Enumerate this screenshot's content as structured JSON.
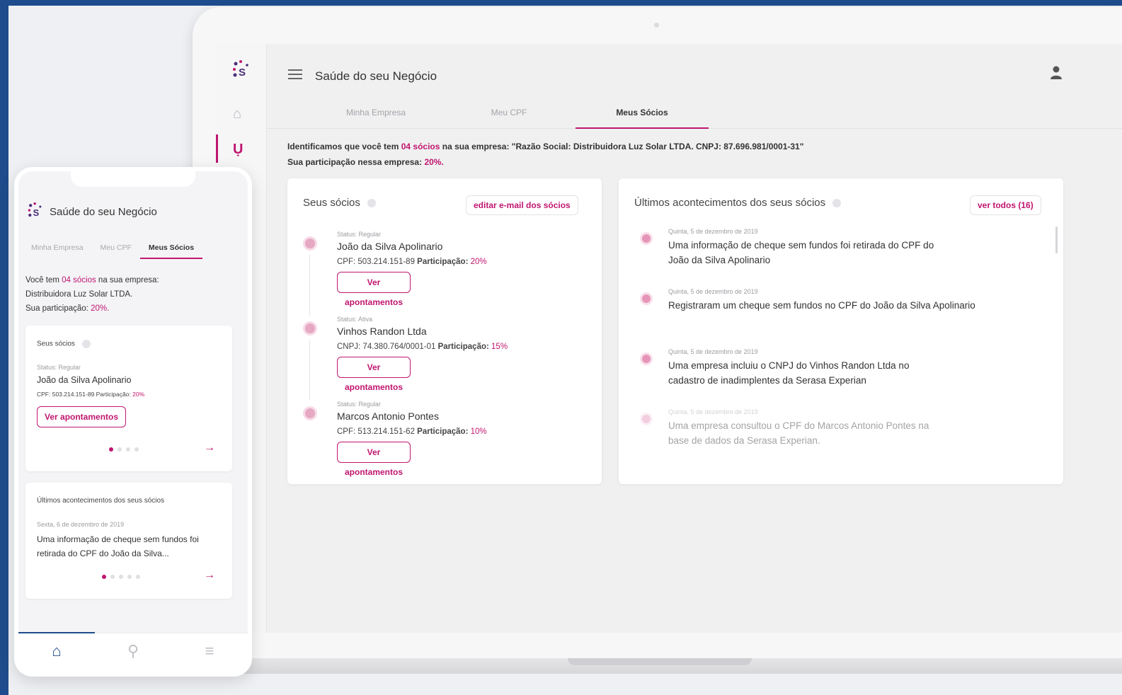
{
  "colors": {
    "brand": "#c0166f",
    "frame": "#1e4c8c",
    "avatar": "#e6a8c3"
  },
  "app": {
    "title": "Saúde do seu Negócio",
    "tabs": [
      {
        "label": "Minha Empresa"
      },
      {
        "label": "Meu CPF"
      },
      {
        "label": "Meus Sócios",
        "active": true
      }
    ]
  },
  "intro": {
    "prefix": "Identificamos que você tem ",
    "count": "04 sócios",
    "suffix": " na sua empresa: \"Razão Social: Distribuidora Luz Solar LTDA. CNPJ: 87.696.981/0001-31\"",
    "participation_prefix": "Sua participação nessa empresa: ",
    "participation": "20%."
  },
  "partners_card": {
    "title": "Seus sócios",
    "edit_button": "editar e-mail dos sócios",
    "partners": [
      {
        "status": "Status: Regular",
        "name": "João da Silva Apolinario",
        "doc": "CPF: 503.214.151-89",
        "part_label": "Participação:",
        "part_value": "20%",
        "button": "Ver apontamentos"
      },
      {
        "status": "Status: Ativa",
        "name": "Vinhos Randon Ltda",
        "doc": "CNPJ: 74.380.764/0001-01",
        "part_label": "Participação:",
        "part_value": "15%",
        "button": "Ver apontamentos"
      },
      {
        "status": "Status: Regular",
        "name": "Marcos Antonio Pontes",
        "doc": "CPF: 513.214.151-62",
        "part_label": "Participação:",
        "part_value": "10%",
        "button": "Ver apontamentos"
      }
    ]
  },
  "events_card": {
    "title": "Últimos acontecimentos dos seus sócios",
    "see_all": "ver todos (16)",
    "events": [
      {
        "date": "Quinta, 5 de dezembro de 2019",
        "text": "Uma informação de cheque sem fundos foi retirada do CPF do João da Silva Apolinario"
      },
      {
        "date": "Quinta, 5 de dezembro de 2019",
        "text": "Registraram um cheque sem fundos no CPF do João da Silva Apolinario"
      },
      {
        "date": "Quinta, 5 de dezembro de 2019",
        "text": "Uma empresa incluiu o CNPJ do Vinhos Randon Ltda no cadastro de inadimplentes da Serasa Experian"
      },
      {
        "date": "Quinta, 5 de dezembro de 2019",
        "text": "Uma empresa consultou o CPF do Marcos Antonio Pontes na base de dados da Serasa Experian."
      }
    ]
  },
  "mobile": {
    "title": "Saúde do seu Negócio",
    "tabs": [
      "Minha Empresa",
      "Meu CPF",
      "Meus Sócios"
    ],
    "intro": {
      "prefix": "Você tem ",
      "count": "04 sócios",
      "suffix": " na sua empresa:",
      "company": "Distribuidora Luz Solar LTDA.",
      "participation_prefix": "Sua participação: ",
      "participation": "20%."
    },
    "partners_card": {
      "title": "Seus sócios",
      "status": "Status: Regular",
      "name": "João da Silva Apolinario",
      "doc": "CPF: 503.214.151-89 Participação:",
      "part_value": "20%",
      "button": "Ver apontamentos",
      "arrow": "→"
    },
    "events_card": {
      "title": "Últimos acontecimentos dos seus sócios",
      "date": "Sexta, 6 de dezembro de 2019",
      "text": "Uma informação de cheque sem fundos foi retirada do CPF do João da Silva...",
      "arrow": "→"
    },
    "bottom_nav": [
      "home-icon",
      "user-icon",
      "menu-icon"
    ]
  }
}
